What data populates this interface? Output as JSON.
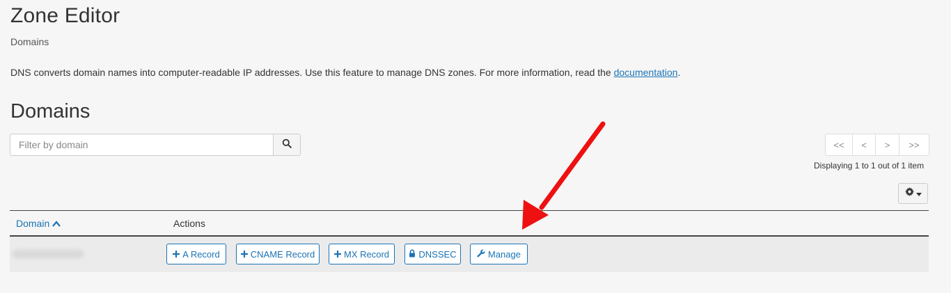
{
  "header": {
    "title": "Zone Editor",
    "breadcrumb": "Domains"
  },
  "intro": {
    "text": "DNS converts domain names into computer-readable IP addresses. Use this feature to manage DNS zones. For more information, read the ",
    "link_text": "documentation",
    "suffix": "."
  },
  "section": {
    "title": "Domains"
  },
  "search": {
    "placeholder": "Filter by domain",
    "value": "",
    "icon": "search-icon"
  },
  "pagination": {
    "first": "<<",
    "prev": "<",
    "next": ">",
    "last": ">>",
    "status": "Displaying 1 to 1 out of 1 item"
  },
  "settings": {
    "icon": "gear-icon"
  },
  "table": {
    "columns": {
      "domain": "Domain",
      "actions": "Actions"
    },
    "rows": [
      {
        "domain": "",
        "actions": [
          {
            "label": "A Record",
            "icon": "plus-icon"
          },
          {
            "label": "CNAME Record",
            "icon": "plus-icon"
          },
          {
            "label": "MX Record",
            "icon": "plus-icon"
          },
          {
            "label": "DNSSEC",
            "icon": "lock-icon"
          },
          {
            "label": "Manage",
            "icon": "wrench-icon"
          }
        ]
      }
    ]
  },
  "colors": {
    "accent": "#1a73b5",
    "annotation_arrow": "#ee1111",
    "background": "#f6f6f6",
    "row_background": "#ebebeb"
  }
}
